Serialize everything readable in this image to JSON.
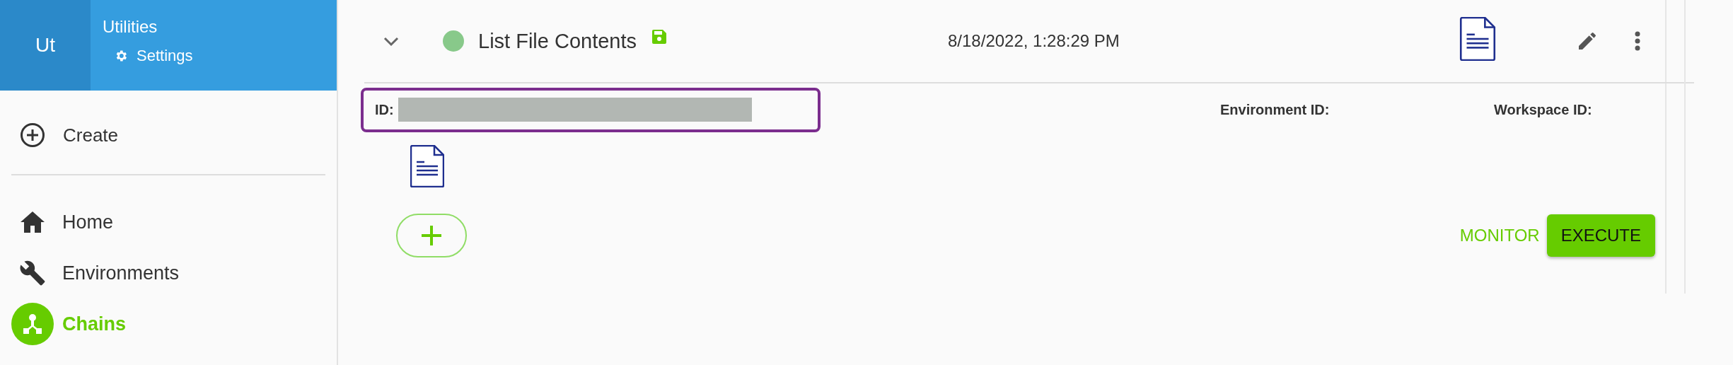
{
  "sidebar": {
    "workspace": {
      "initials": "Ut",
      "name": "Utilities",
      "settings": "Settings"
    },
    "create": "Create",
    "nav": [
      {
        "kind": "home",
        "label": "Home",
        "selected": false
      },
      {
        "kind": "wrench",
        "label": "Environments",
        "selected": false
      },
      {
        "kind": "chains",
        "label": "Chains",
        "selected": true
      }
    ]
  },
  "chain": {
    "expanded": true,
    "title": "List File Contents",
    "saved": true,
    "timestamp": "8/18/2022, 1:28:29 PM",
    "id_label": "ID:",
    "id_highlighted": true,
    "environment_label": "Environment ID:",
    "workspace_label": "Workspace ID:"
  },
  "actions": {
    "monitor": "MONITOR",
    "execute": "EXECUTE"
  }
}
